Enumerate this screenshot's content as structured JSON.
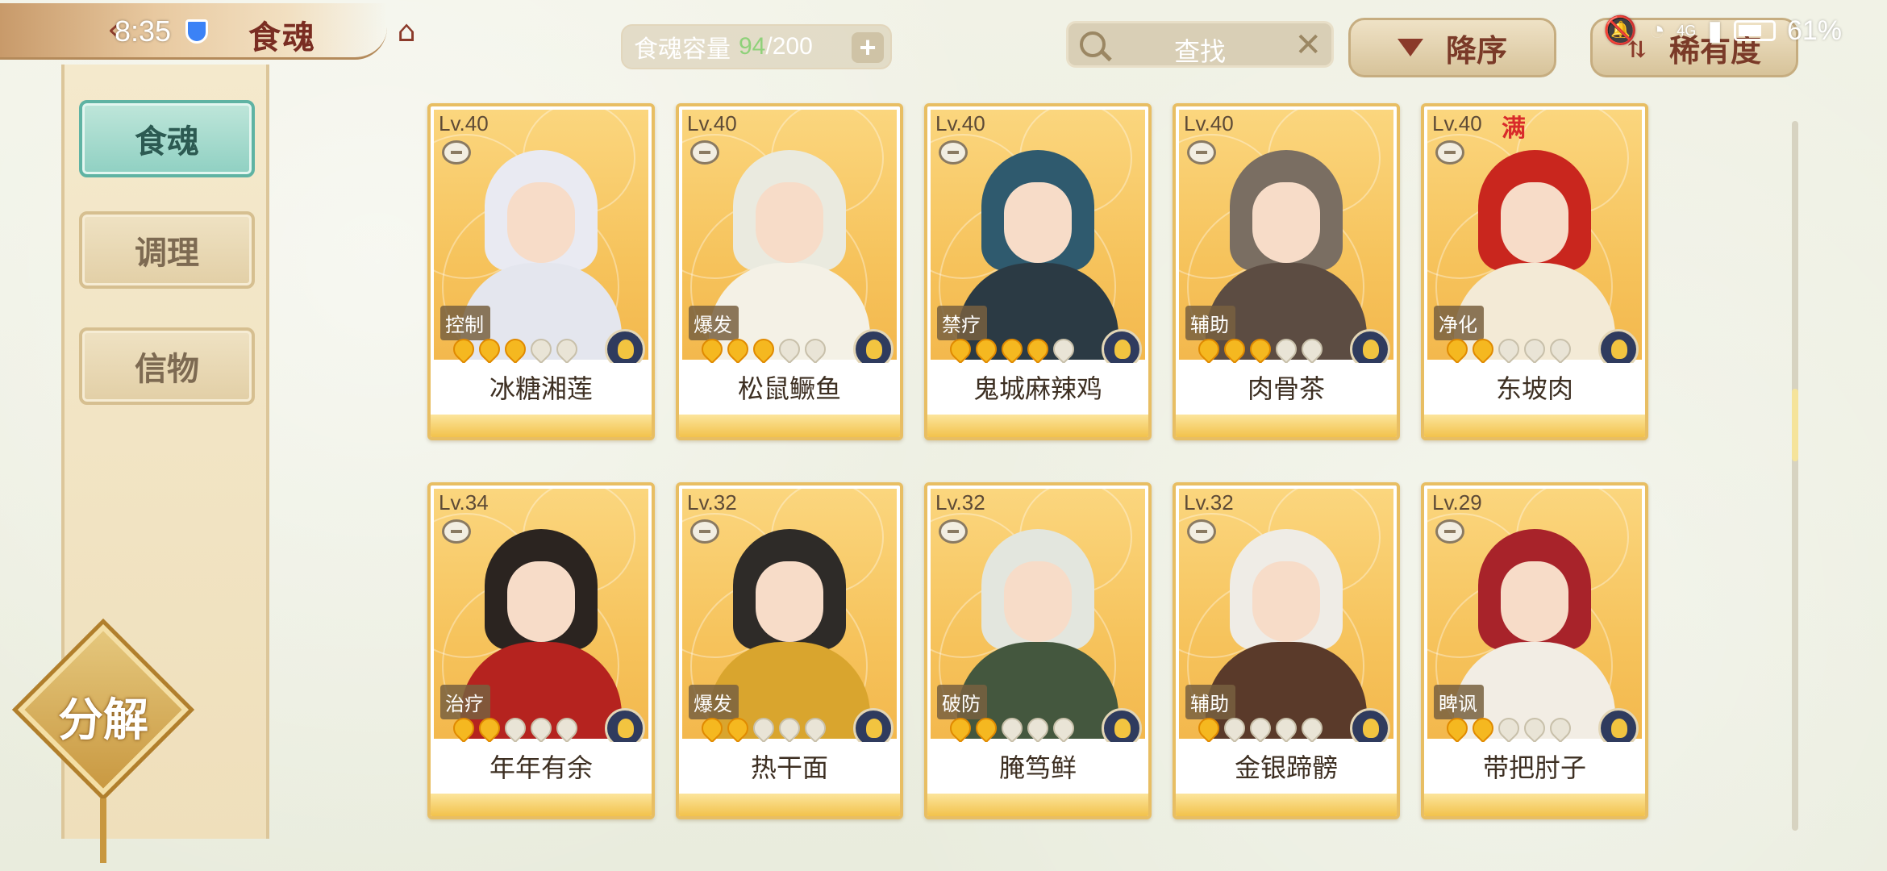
{
  "status_bar": {
    "time": "8:35",
    "network": "4G",
    "battery": "61%"
  },
  "header": {
    "title": "食魂",
    "capacity_label": "食魂容量",
    "capacity_current": "94",
    "capacity_max": "/200",
    "add_label": "+",
    "search_label": "查找",
    "clear_label": "✕",
    "sort_order_label": "降序",
    "sort_field_label": "稀有度"
  },
  "sidebar": {
    "items": [
      {
        "label": "食魂",
        "active": true
      },
      {
        "label": "调理",
        "active": false
      },
      {
        "label": "信物",
        "active": false
      }
    ],
    "decompose_label": "分解"
  },
  "cards": [
    {
      "level": "Lv.40",
      "role": "控制",
      "name": "冰糖湘莲",
      "stars": 3,
      "full": "",
      "hair": "#e9eaf2",
      "body": "#e4e6ee"
    },
    {
      "level": "Lv.40",
      "role": "爆发",
      "name": "松鼠鳜鱼",
      "stars": 3,
      "full": "",
      "hair": "#eaeadf",
      "body": "#f4f1e6"
    },
    {
      "level": "Lv.40",
      "role": "禁疗",
      "name": "鬼城麻辣鸡",
      "stars": 4,
      "full": "",
      "hair": "#2f5a6e",
      "body": "#2b3a44"
    },
    {
      "level": "Lv.40",
      "role": "辅助",
      "name": "肉骨茶",
      "stars": 3,
      "full": "",
      "hair": "#7a6e62",
      "body": "#5c4c42"
    },
    {
      "level": "Lv.40",
      "role": "净化",
      "name": "东坡肉",
      "stars": 2,
      "full": "满",
      "hair": "#c9261e",
      "body": "#f3ead6"
    },
    {
      "level": "Lv.34",
      "role": "治疗",
      "name": "年年有余",
      "stars": 2,
      "full": "",
      "hair": "#2b2420",
      "body": "#b5231f"
    },
    {
      "level": "Lv.32",
      "role": "爆发",
      "name": "热干面",
      "stars": 2,
      "full": "",
      "hair": "#2e2b28",
      "body": "#d9a52e"
    },
    {
      "level": "Lv.32",
      "role": "破防",
      "name": "腌笃鲜",
      "stars": 2,
      "full": "",
      "hair": "#e3e6de",
      "body": "#44573e"
    },
    {
      "level": "Lv.32",
      "role": "辅助",
      "name": "金银蹄髈",
      "stars": 1,
      "full": "",
      "hair": "#efece6",
      "body": "#5a3a2a"
    },
    {
      "level": "Lv.29",
      "role": "睥讽",
      "name": "带把肘子",
      "stars": 2,
      "full": "",
      "hair": "#a8232a",
      "body": "#f2ede4"
    }
  ],
  "scroll_position": 0.42
}
